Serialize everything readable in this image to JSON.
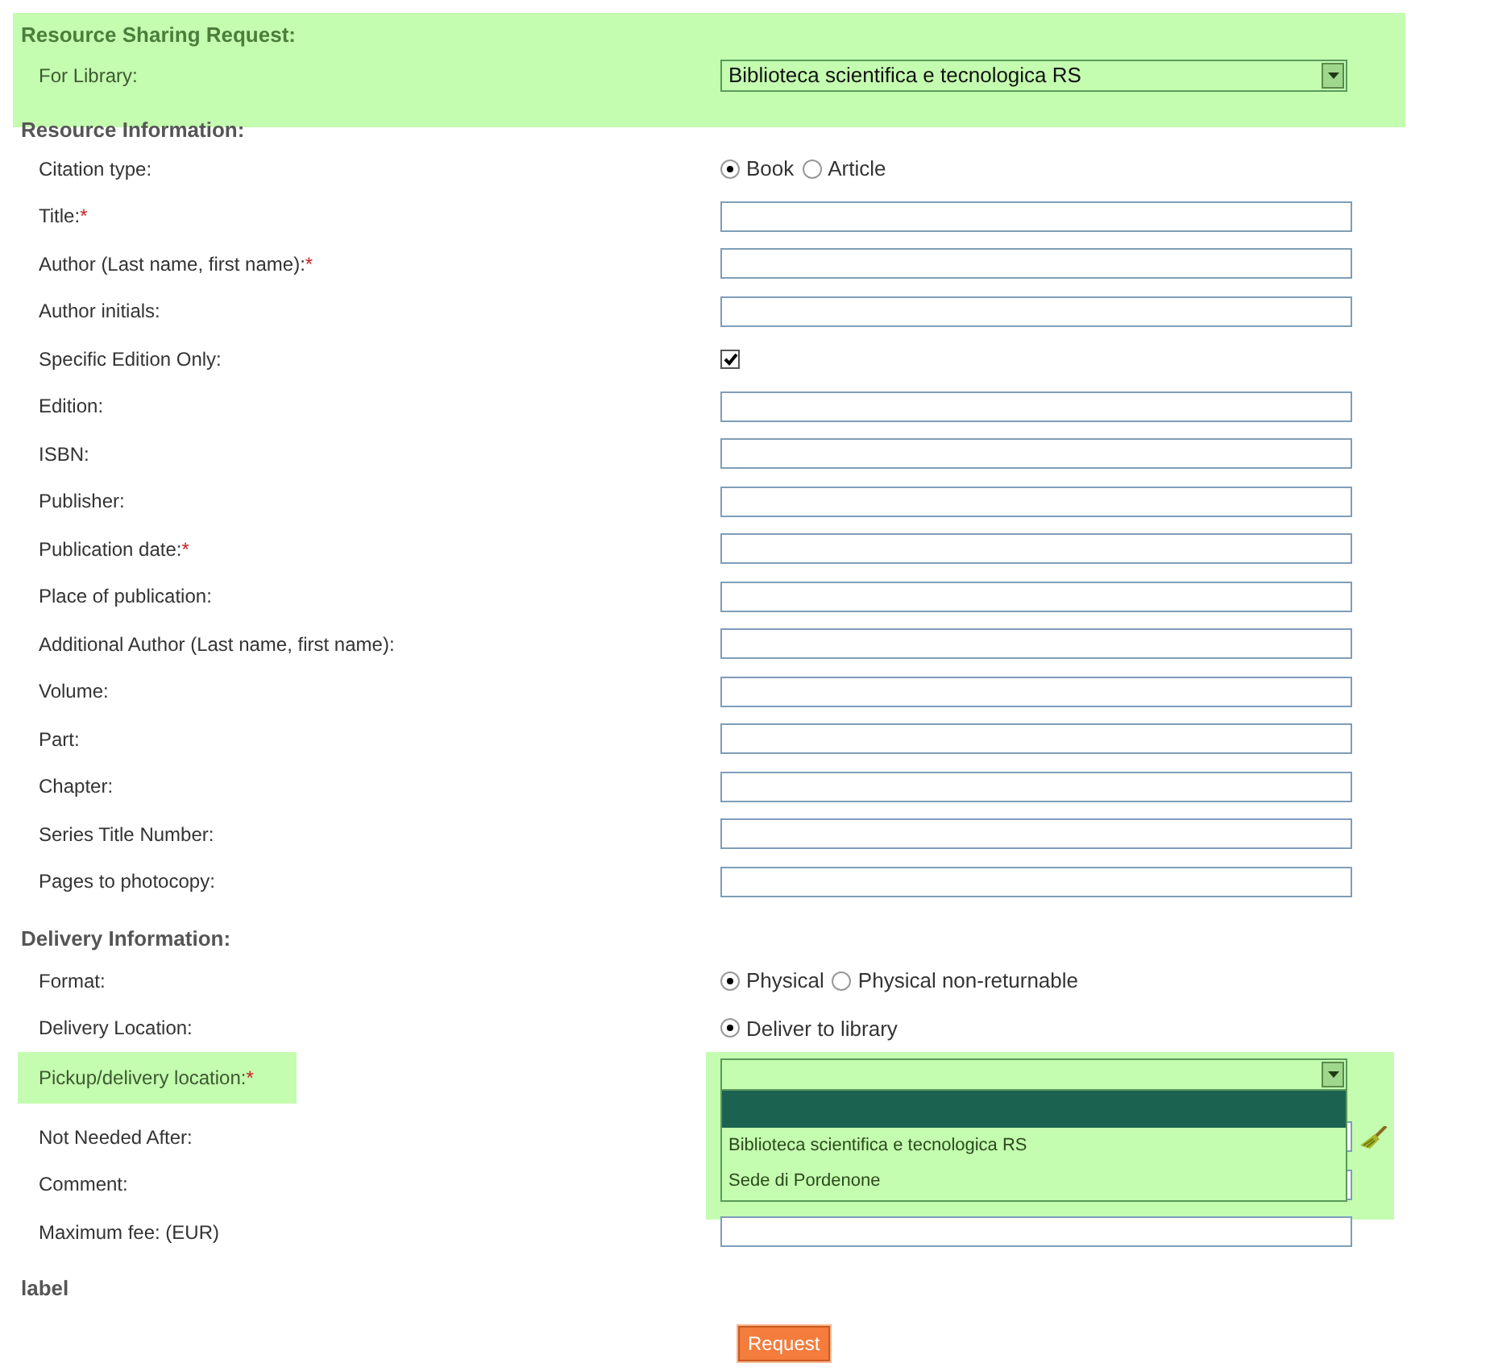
{
  "sections": [
    {
      "title": "Resource Sharing Request:",
      "highlighted": true,
      "fields": [
        {
          "kind": "select",
          "label": "For Library:",
          "value": "Biblioteca scientifica e tecnologica RS"
        }
      ]
    },
    {
      "title": "Resource Information:",
      "highlighted": false,
      "fields": [
        {
          "kind": "radio",
          "label": "Citation type:",
          "options": [
            {
              "label": "Book",
              "selected": true
            },
            {
              "label": "Article",
              "selected": false
            }
          ]
        },
        {
          "kind": "text",
          "label": "Title:",
          "mark": "*"
        },
        {
          "kind": "text",
          "label": "Author (Last name, first name):",
          "mark": "*"
        },
        {
          "kind": "text",
          "label": "Author initials:"
        },
        {
          "kind": "checkbox",
          "label": "Specific Edition Only:",
          "checked": true
        },
        {
          "kind": "text",
          "label": "Edition:"
        },
        {
          "kind": "text",
          "label": "ISBN:"
        },
        {
          "kind": "text",
          "label": "Publisher:"
        },
        {
          "kind": "text",
          "label": "Publication date:",
          "mark": "*"
        },
        {
          "kind": "text",
          "label": "Place of publication:"
        },
        {
          "kind": "text",
          "label": "Additional Author (Last name, first name):"
        },
        {
          "kind": "text",
          "label": "Volume:"
        },
        {
          "kind": "text",
          "label": "Part:"
        },
        {
          "kind": "text",
          "label": "Chapter:"
        },
        {
          "kind": "text",
          "label": "Series Title Number:"
        },
        {
          "kind": "text",
          "label": "Pages to photocopy:"
        }
      ]
    },
    {
      "title": "Delivery Information:",
      "highlighted": false,
      "fields": [
        {
          "kind": "radio",
          "label": "Format:",
          "options": [
            {
              "label": "Physical",
              "selected": true
            },
            {
              "label": "Physical non-returnable",
              "selected": false
            }
          ]
        },
        {
          "kind": "radio",
          "label": "Delivery Location:",
          "options": [
            {
              "label": "Deliver to library",
              "selected": true
            }
          ]
        },
        {
          "kind": "dropdown",
          "label": "Pickup/delivery location:",
          "mark": "*",
          "highlighted": true,
          "open": true,
          "options": [
            {
              "selected": true
            },
            {
              "label": "Biblioteca scientifica e tecnologica RS",
              "selected": false
            },
            {
              "label": "Sede di Pordenone",
              "selected": false
            }
          ]
        },
        {
          "kind": "date",
          "label": "Not Needed After:"
        },
        {
          "kind": "text",
          "label": "Comment:"
        },
        {
          "kind": "text",
          "label": "Maximum fee: (EUR)"
        }
      ]
    },
    {
      "title": "label",
      "highlighted": false
    }
  ],
  "submit_button": "Request"
}
